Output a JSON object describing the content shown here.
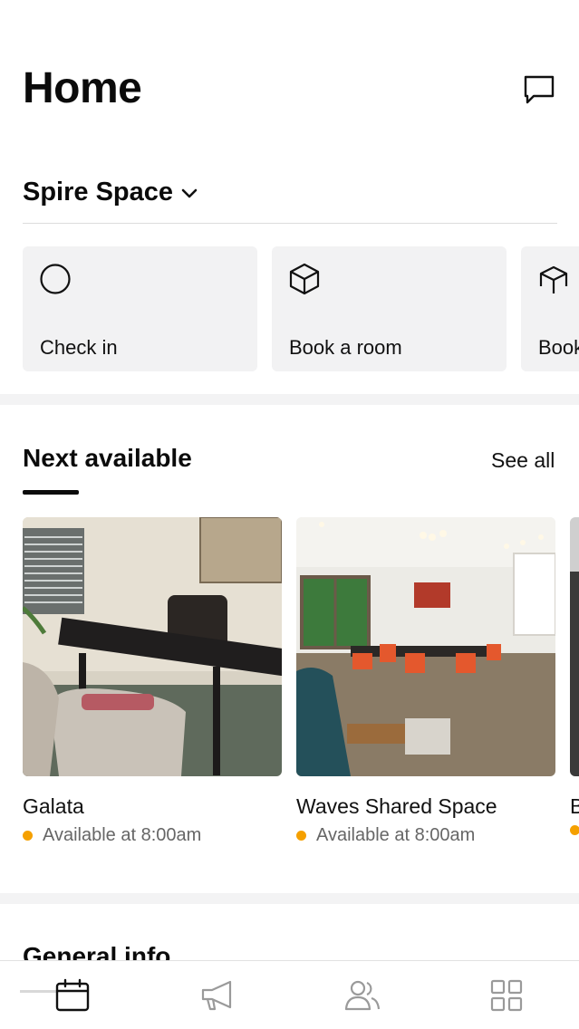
{
  "header": {
    "title": "Home",
    "chat_icon": "chat-bubble-icon"
  },
  "space": {
    "name": "Spire Space",
    "dropdown_icon": "chevron-down-icon"
  },
  "quick_actions": [
    {
      "label": "Check in",
      "icon": "circle-icon"
    },
    {
      "label": "Book a room",
      "icon": "cube-icon"
    },
    {
      "label": "Book",
      "icon": "open-box-icon"
    }
  ],
  "next_available": {
    "title": "Next available",
    "see_all_label": "See all",
    "rooms": [
      {
        "name": "Galata",
        "status": "Available at 8:00am",
        "status_color": "#f5a000"
      },
      {
        "name": "Waves Shared Space",
        "status": "Available at 8:00am",
        "status_color": "#f5a000"
      },
      {
        "name": "B",
        "status": "",
        "status_color": "#f5a000"
      }
    ]
  },
  "general_info": {
    "title": "General info"
  },
  "tabbar": {
    "tabs": [
      {
        "name": "calendar-icon",
        "active": true
      },
      {
        "name": "megaphone-icon",
        "active": false
      },
      {
        "name": "people-icon",
        "active": false
      },
      {
        "name": "grid-icon",
        "active": false
      }
    ],
    "active_color": "#111111",
    "inactive_color": "#9a9a9a"
  },
  "colors": {
    "card_bg": "#f2f2f3",
    "accent_status": "#f5a000",
    "text_primary": "#0b0b0b"
  }
}
